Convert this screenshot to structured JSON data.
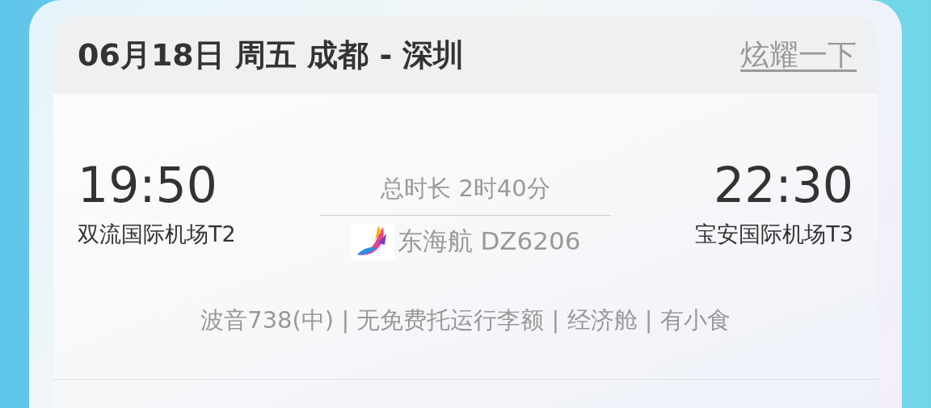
{
  "header": {
    "title": "06月18日 周五 成都 - 深圳",
    "share_link": "炫耀一下"
  },
  "departure": {
    "time": "19:50",
    "airport": "双流国际机场T2"
  },
  "duration": "总时长 2时40分",
  "flight": "东海航 DZ6206",
  "arrival": {
    "time": "22:30",
    "airport": "宝安国际机场T3"
  },
  "details": "波音738(中) | 无免费托运行李额 | 经济舱 | 有小食"
}
